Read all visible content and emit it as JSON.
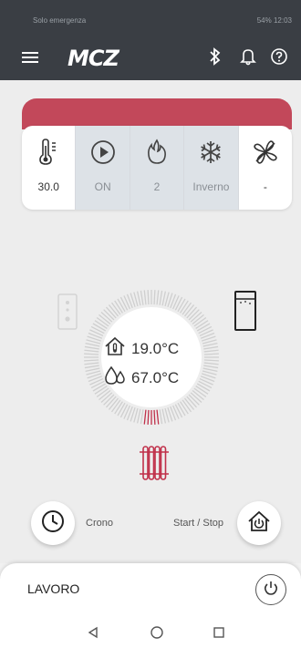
{
  "status_bar": {
    "left_text": "Solo emergenza",
    "right_text": "54% 12:03"
  },
  "app_bar": {
    "logo": "MCZ",
    "icons": [
      "menu-icon",
      "bluetooth-icon",
      "bell-icon",
      "help-icon"
    ]
  },
  "status_tiles": [
    {
      "icon": "thermometer-icon",
      "value": "30.0"
    },
    {
      "icon": "play-icon",
      "value": "ON"
    },
    {
      "icon": "flame-icon",
      "value": "2"
    },
    {
      "icon": "snowflake-icon",
      "value": "Inverno"
    },
    {
      "icon": "fan-icon",
      "value": "-"
    }
  ],
  "dial": {
    "room_temp": "19.0°C",
    "water_temp": "67.0°C"
  },
  "actions": {
    "crono_label": "Crono",
    "start_stop_label": "Start / Stop"
  },
  "panel": {
    "title": "LAVORO"
  },
  "colors": {
    "app_bar": "#3a3e44",
    "accent_red": "#c2485a"
  }
}
